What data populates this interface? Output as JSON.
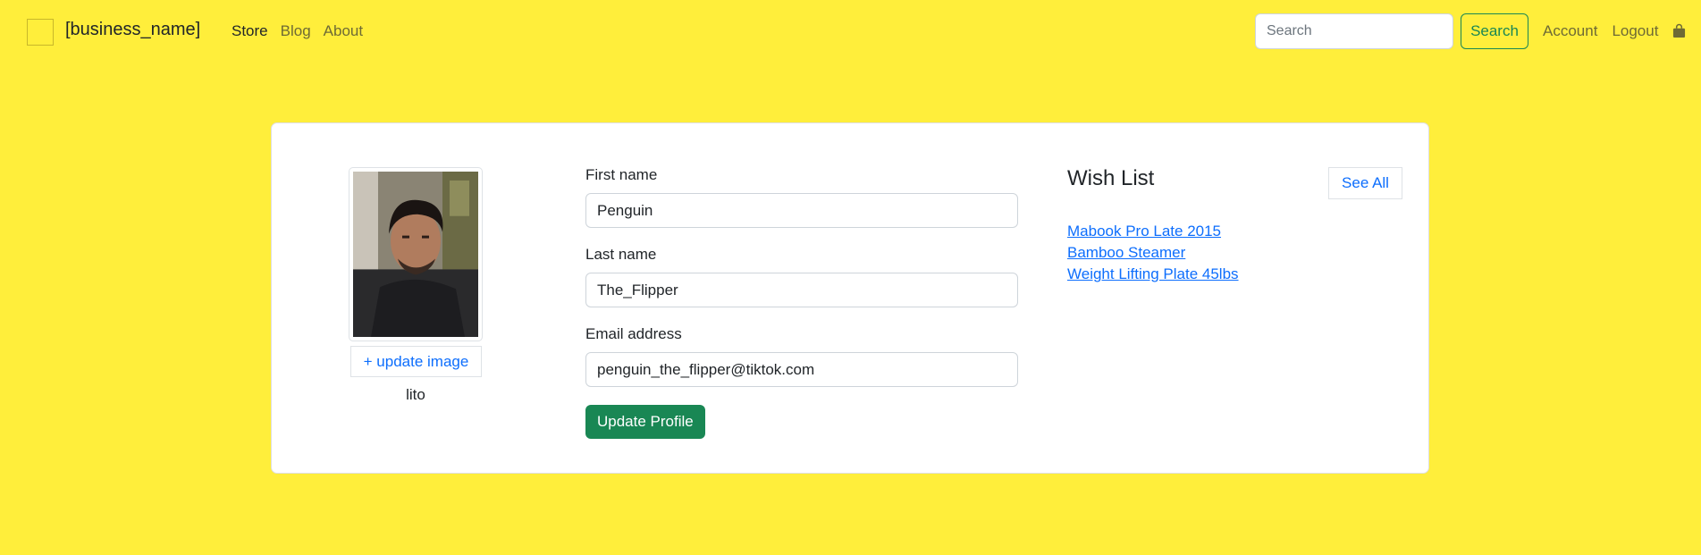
{
  "nav": {
    "brand": "[business_name]",
    "links": [
      "Store",
      "Blog",
      "About"
    ],
    "search_placeholder": "Search",
    "search_button": "Search",
    "account": "Account",
    "logout": "Logout",
    "cart_icon": "shopping-bag-icon"
  },
  "profile": {
    "update_image_label": "+ update image",
    "username": "lito"
  },
  "form": {
    "first_name_label": "First name",
    "first_name_value": "Penguin",
    "last_name_label": "Last name",
    "last_name_value": "The_Flipper",
    "email_label": "Email address",
    "email_value": "penguin_the_flipper@tiktok.com",
    "submit_label": "Update Profile"
  },
  "wishlist": {
    "title": "Wish List",
    "see_all": "See All",
    "items": [
      "Mabook Pro Late 2015",
      "Bamboo Steamer",
      "Weight Lifting Plate 45lbs"
    ]
  },
  "colors": {
    "background": "#ffee3b",
    "success": "#198754",
    "link": "#0d6efd"
  }
}
